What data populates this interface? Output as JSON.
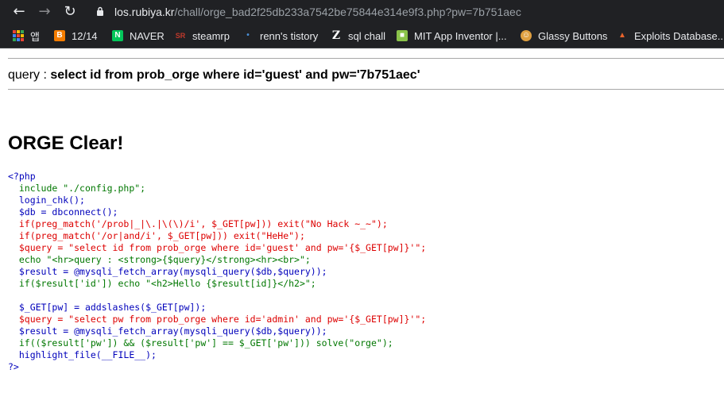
{
  "browser": {
    "url_host": "los.rubiya.kr",
    "url_path": "/chall/orge_bad2f25db233a7542be75844e314e9f3.php?pw=7b751aec",
    "bookmarks": [
      {
        "label": "앱",
        "icon": "apps-grid-icon"
      },
      {
        "label": "12/14",
        "icon": "blogger-icon",
        "color": "#f57d00"
      },
      {
        "label": "NAVER",
        "icon": "naver-icon",
        "color": "#03c75a"
      },
      {
        "label": "steamrp",
        "icon": "sr-icon",
        "color": "#c0392b"
      },
      {
        "label": "renn's tistory",
        "icon": "tistory-icon",
        "color": "#4a90d9"
      },
      {
        "label": "sql chall",
        "icon": "z-icon",
        "color": "#ffffff"
      },
      {
        "label": "MIT App Inventor |...",
        "icon": "app-inventor-icon",
        "color": "#8bc34a"
      },
      {
        "label": "Glassy Buttons",
        "icon": "glassy-icon",
        "color": "#e0a040"
      },
      {
        "label": "Exploits Database...",
        "icon": "exploit-db-icon",
        "color": "#e8632b"
      }
    ]
  },
  "page": {
    "query_label": "query : ",
    "query_text": "select id from prob_orge where id='guest' and pw='7b751aec'",
    "clear_title": "ORGE Clear!",
    "code": {
      "php_open": "<?php",
      "l1": "include \"./config.php\";",
      "l2": "login_chk();",
      "l3": "$db = dbconnect();",
      "l4": "if(preg_match('/prob|_|\\.|\\(\\)/i', $_GET[pw])) exit(\"No Hack ~_~\");",
      "l5": "if(preg_match('/or|and/i', $_GET[pw])) exit(\"HeHe\");",
      "l6": "$query = \"select id from prob_orge where id='guest' and pw='{$_GET[pw]}'\";",
      "l7": "echo \"<hr>query : <strong>{$query}</strong><hr><br>\";",
      "l8": "$result = @mysqli_fetch_array(mysqli_query($db,$query));",
      "l9": "if($result['id']) echo \"<h2>Hello {$result[id]}</h2>\";",
      "l10": "$_GET[pw] = addslashes($_GET[pw]);",
      "l11": "$query = \"select pw from prob_orge where id='admin' and pw='{$_GET[pw]}'\";",
      "l12": "$result = @mysqli_fetch_array(mysqli_query($db,$query));",
      "l13": "if(($result['pw']) && ($result['pw'] == $_GET['pw'])) solve(\"orge\");",
      "l14": "highlight_file(__FILE__);",
      "php_close": "?>"
    }
  }
}
